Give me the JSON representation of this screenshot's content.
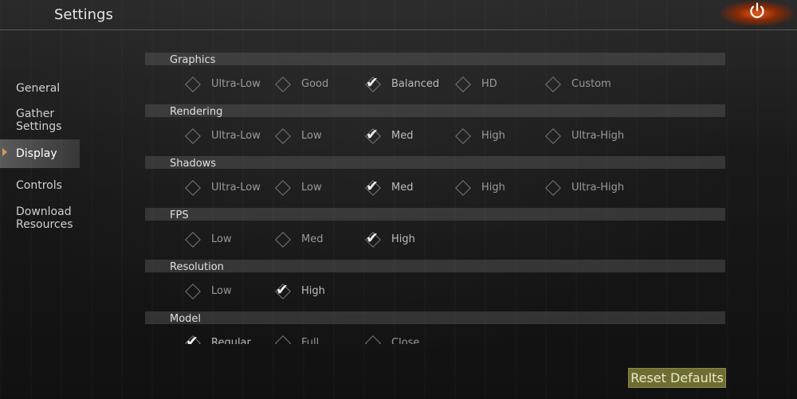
{
  "header": {
    "title": "Settings",
    "power_icon": "power-icon"
  },
  "sidebar": {
    "items": [
      {
        "label": "General",
        "active": false
      },
      {
        "label": "Gather\nSettings",
        "active": false
      },
      {
        "label": "Display",
        "active": true
      },
      {
        "label": "Controls",
        "active": false
      },
      {
        "label": "Download\nResources",
        "active": false
      }
    ]
  },
  "sections": [
    {
      "title": "Graphics",
      "options": [
        "Ultra-Low",
        "Good",
        "Balanced",
        "HD",
        "Custom"
      ],
      "selected": 2
    },
    {
      "title": "Rendering",
      "options": [
        "Ultra-Low",
        "Low",
        "Med",
        "High",
        "Ultra-High"
      ],
      "selected": 2
    },
    {
      "title": "Shadows",
      "options": [
        "Ultra-Low",
        "Low",
        "Med",
        "High",
        "Ultra-High"
      ],
      "selected": 2
    },
    {
      "title": "FPS",
      "options": [
        "Low",
        "Med",
        "High"
      ],
      "selected": 2
    },
    {
      "title": "Resolution",
      "options": [
        "Low",
        "High"
      ],
      "selected": 1
    },
    {
      "title": "Model",
      "options": [
        "Regular",
        "Full",
        "Close"
      ],
      "selected": 0
    }
  ],
  "footer": {
    "reset_label": "Reset Defaults"
  },
  "colors": {
    "accent_power": "#e25a1a",
    "reset_button": "#6e6e32",
    "active_arrow": "#d69a5a"
  }
}
